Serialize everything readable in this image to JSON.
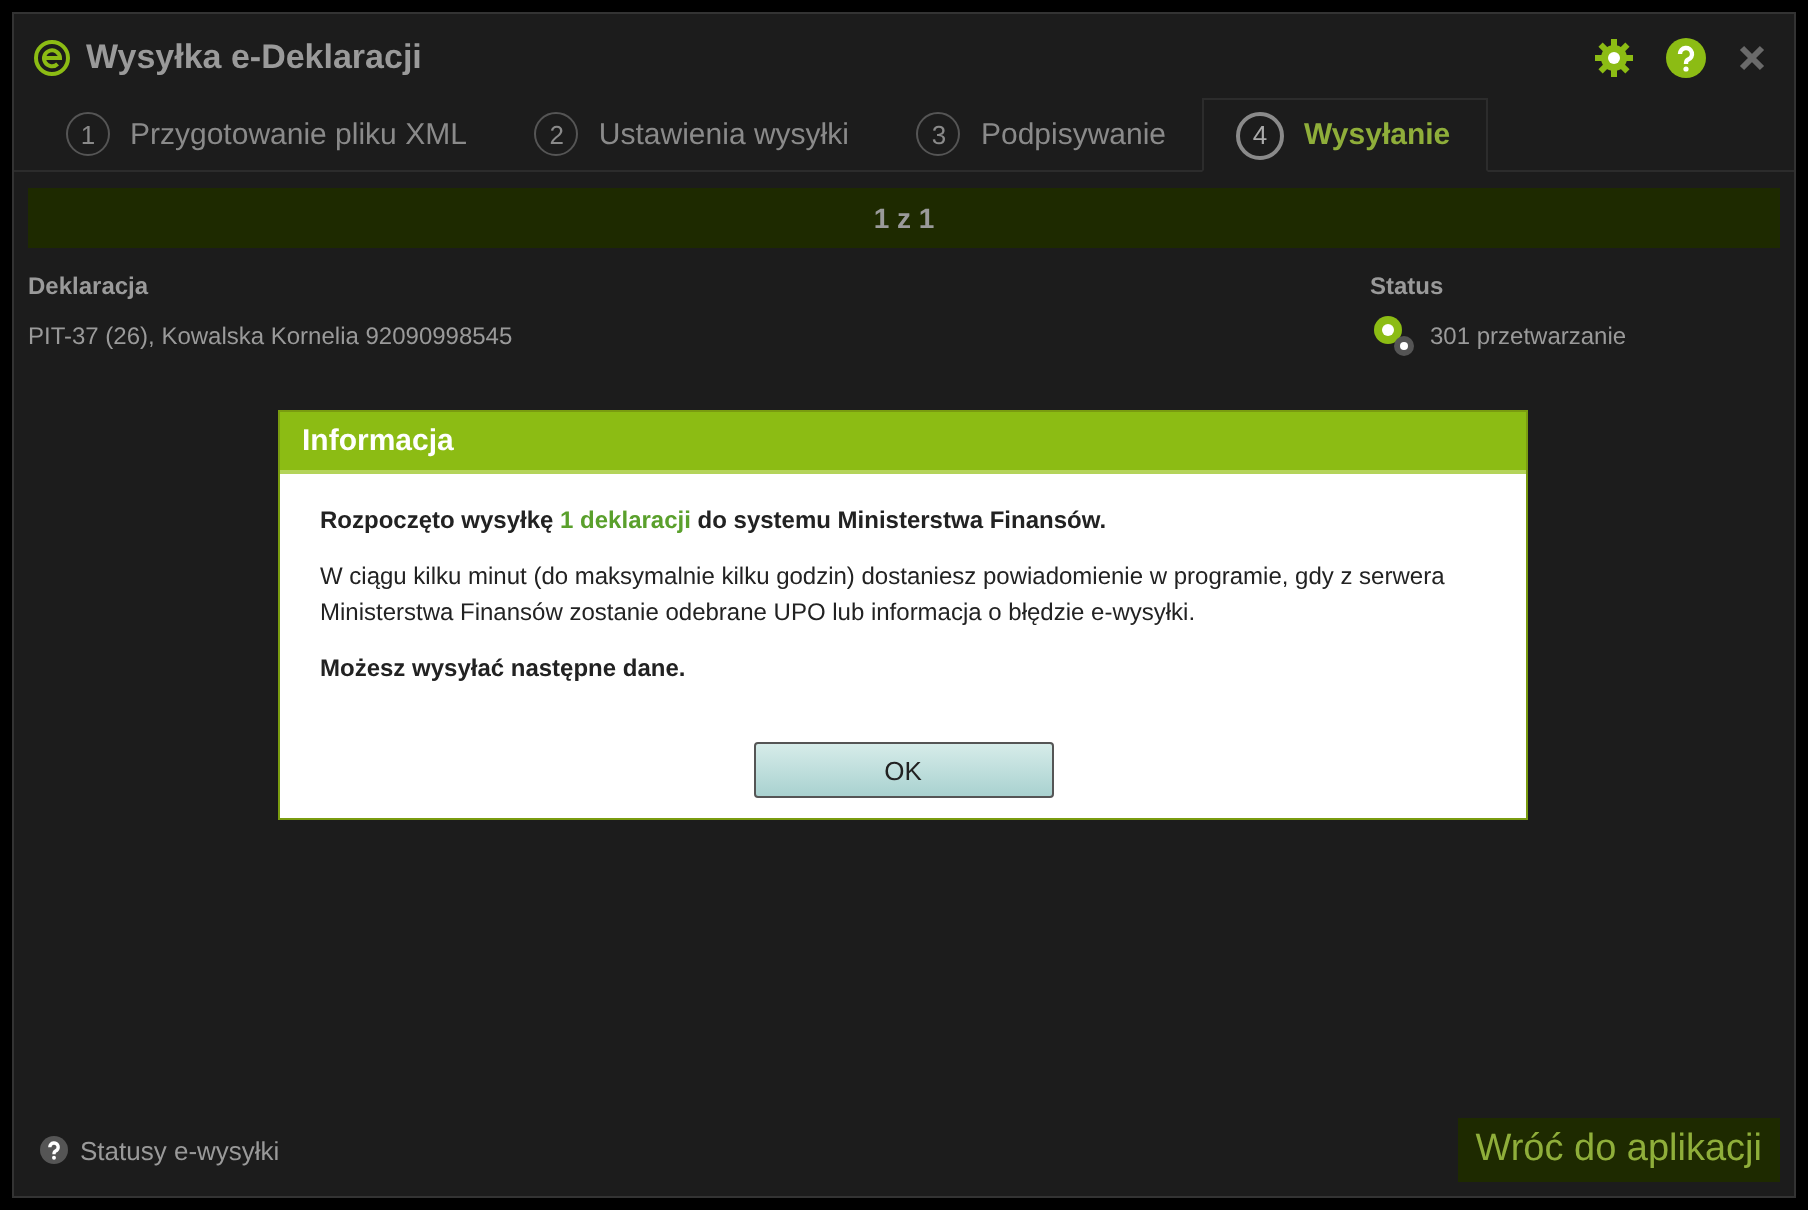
{
  "window": {
    "title": "Wysyłka e-Deklaracji"
  },
  "tabs": [
    {
      "number": "1",
      "label": "Przygotowanie pliku XML",
      "selected": false
    },
    {
      "number": "2",
      "label": "Ustawienia wysyłki",
      "selected": false
    },
    {
      "number": "3",
      "label": "Podpisywanie",
      "selected": false
    },
    {
      "number": "4",
      "label": "Wysyłanie",
      "selected": true
    }
  ],
  "progress": {
    "text": "1 z 1",
    "level": 1
  },
  "table": {
    "columns": [
      "Deklaracja",
      "Status"
    ],
    "rows": [
      {
        "declaration": "PIT-37 (26), Kowalska Kornelia 92090998545",
        "status": "301 przetwarzanie"
      }
    ]
  },
  "footer": {
    "help_link": "Statusy e-wysyłki",
    "button": "Wróć do aplikacji"
  },
  "dialog": {
    "title": "Informacja",
    "paragraphs": [
      {
        "segments": [
          {
            "text": "Rozpoczęto wysyłkę",
            "link": false
          },
          {
            "text": "1 deklaracji",
            "link": true
          },
          {
            "text": "do systemu Ministerstwa Finansów.",
            "link": false
          }
        ],
        "bold": true
      },
      {
        "text": "W ciągu kilku minut (do maksymalnie kilku godzin) dostaniesz powiadomienie w programie, gdy z serwera Ministerstwa Finansów zostanie odebrane UPO lub informacja o błędzie e-wysyłki.",
        "bold": false
      },
      {
        "text": "Możesz wysyłać następne dane.",
        "bold": true
      }
    ],
    "button": "OK"
  }
}
